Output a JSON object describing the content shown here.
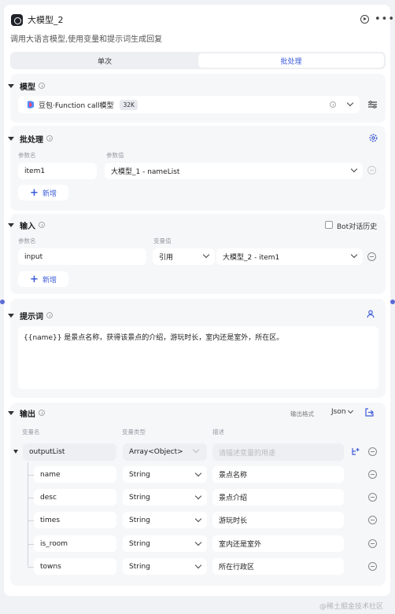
{
  "node": {
    "title": "大模型_2",
    "description": "调用大语言模型,使用变量和提示词生成回复"
  },
  "tabs": [
    {
      "label": "单次"
    },
    {
      "label": "批处理"
    }
  ],
  "model": {
    "section_label": "模型",
    "name": "豆包·Function call模型",
    "badge": "32K"
  },
  "batch": {
    "section_label": "批处理",
    "col_param": "参数名",
    "col_value": "参数值",
    "row": {
      "name": "item1",
      "value": "大模型_1 - nameList"
    },
    "add_label": "新增"
  },
  "input": {
    "section_label": "输入",
    "bot_history_label": "Bot对话历史",
    "col_param": "参数名",
    "col_value": "变量值",
    "row": {
      "name": "input",
      "type": "引用",
      "value": "大模型_2 - item1"
    },
    "add_label": "新增"
  },
  "prompt": {
    "section_label": "提示词",
    "text": "{{name}} 是景点名称，获得该景点的介绍，游玩时长，室内还是室外，所在区。"
  },
  "output": {
    "section_label": "输出",
    "format_label": "输出格式",
    "format_value": "Json",
    "col_name": "变量名",
    "col_type": "变量类型",
    "col_desc": "描述",
    "root": {
      "name": "outputList",
      "type": "Array<Object>",
      "desc_placeholder": "请描述变量的用途"
    },
    "children": [
      {
        "name": "name",
        "type": "String",
        "desc": "景点名称"
      },
      {
        "name": "desc",
        "type": "String",
        "desc": "景点介绍"
      },
      {
        "name": "times",
        "type": "String",
        "desc": "游玩时长"
      },
      {
        "name": "is_room",
        "type": "String",
        "desc": "室内还是室外"
      },
      {
        "name": "towns",
        "type": "String",
        "desc": "所在行政区"
      }
    ]
  },
  "watermark": "@稀土掘金技术社区",
  "colors": {
    "accent": "#3c5bd9",
    "section_bg": "#f6f7f9",
    "page_bg": "#f1f2f5"
  }
}
